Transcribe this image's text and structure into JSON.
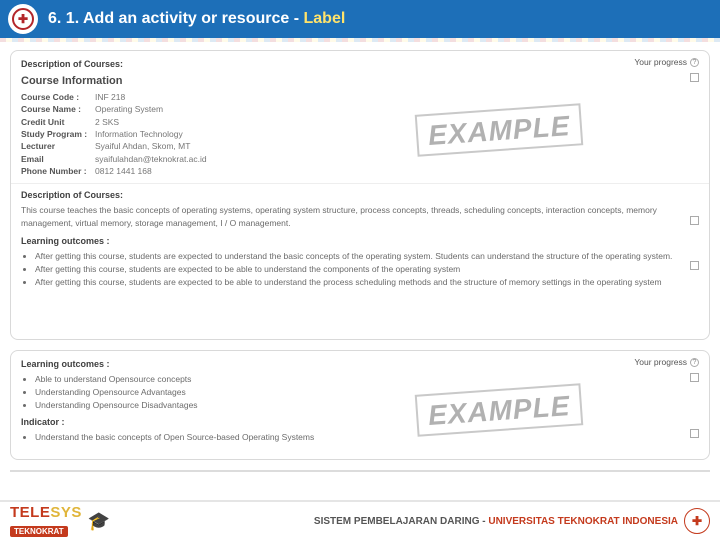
{
  "header": {
    "title_prefix": "6. 1. Add an activity or resource - ",
    "title_emph": "Label"
  },
  "labels": {
    "progress": "Your progress",
    "q": "?"
  },
  "panel1": {
    "desc_label": "Description of Courses:",
    "course_info_title": "Course Information",
    "kv": {
      "course_code_k": "Course Code :",
      "course_code_v": "INF 218",
      "course_name_k": "Course Name :",
      "course_name_v": "Operating System",
      "credit_unit_k": "Credit Unit",
      "credit_unit_v": "2 SKS",
      "study_program_k": "Study Program :",
      "study_program_v": "Information Technology",
      "lecturer_k": "Lecturer",
      "lecturer_v": "Syaiful Ahdan, Skom, MT",
      "email_k": "Email",
      "email_v": "syaifulahdan@teknokrat.ac.id",
      "phone_k": "Phone Number :",
      "phone_v": "0812 1441 168"
    },
    "stamp": "EXAMPLE",
    "desc2_label": "Description of Courses:",
    "desc2_text": "This course teaches the basic concepts of operating systems, operating system structure, process concepts, threads, scheduling concepts, interaction concepts, memory management, virtual memory, storage management, I / O management.",
    "lo_label": "Learning outcomes :",
    "lo_items": [
      "After getting this course, students are expected to understand the basic concepts of the operating system. Students can understand the structure of the operating system.",
      "After getting this course, students are expected to be able to understand the components of the operating system",
      "After getting this course, students are expected to be able to understand the process scheduling methods and the structure of memory settings in the operating system"
    ]
  },
  "panel2": {
    "lo_label": "Learning outcomes :",
    "lo_items": [
      "Able to understand Opensource concepts",
      "Understanding Opensource Advantages",
      "Understanding Opensource Disadvantages"
    ],
    "indicator_label": "Indicator :",
    "indicator_items": [
      "Understand the basic concepts of Open Source-based Operating Systems"
    ],
    "stamp": "EXAMPLE"
  },
  "footer": {
    "brand_a": "TELE",
    "brand_b": "SYS",
    "sub": "TEKNOKRAT",
    "text_grey": "SISTEM PEMBELAJARAN DARING - ",
    "text_red": "UNIVERSITAS TEKNOKRAT INDONESIA"
  }
}
